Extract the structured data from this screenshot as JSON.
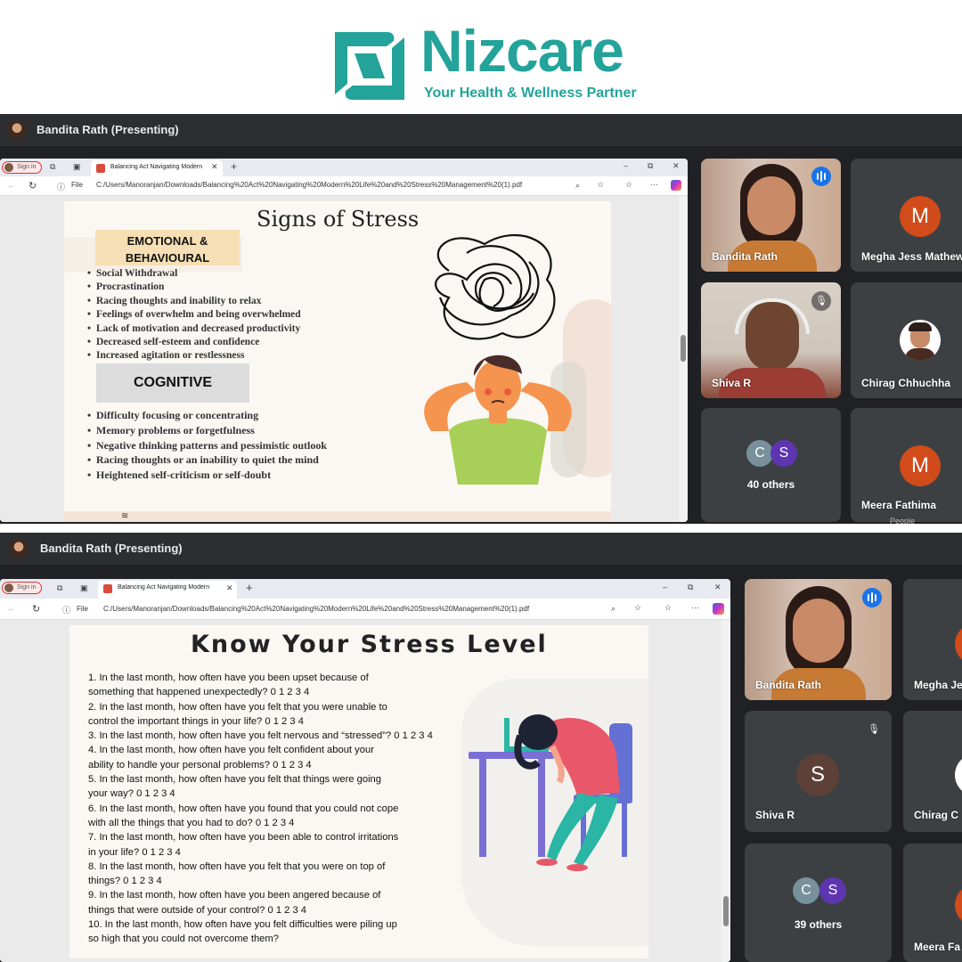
{
  "brand": {
    "name": "Nizcare",
    "tagline": "Your Health & Wellness Partner",
    "color": "#23a39a"
  },
  "screen1": {
    "presenter": "Bandita Rath (Presenting)",
    "browser": {
      "sign_in": "Sign in",
      "tab_title": "Balancing Act Navigating Modern",
      "file_label": "File",
      "url": "C:/Users/Manoranjan/Downloads/Balancing%20Act%20Navigating%20Modern%20Life%20and%20Stress%20Management%20(1).pdf"
    },
    "slide": {
      "title": "Signs of Stress",
      "section1": [
        "EMOTIONAL &",
        "BEHAVIOURAL"
      ],
      "items1": [
        "Social Withdrawal",
        "Procrastination",
        "Racing thoughts and inability to relax",
        "Feelings of overwhelm and being overwhelmed",
        "Lack of motivation and decreased productivity",
        "Decreased self-esteem and confidence",
        "Increased agitation or restlessness"
      ],
      "section2": "COGNITIVE",
      "items2": [
        "Difficulty focusing or concentrating",
        "Memory problems or forgetfulness",
        "Negative thinking patterns and pessimistic outlook",
        "Racing thoughts or an inability to quiet the mind",
        "Heightened self-criticism or self-doubt"
      ]
    },
    "participants": {
      "p1": "Bandita Rath",
      "p2": {
        "name": "Megha Jess Mathew",
        "initial": "M"
      },
      "p3": "Shiva R",
      "p4": "Chirag Chhuchha",
      "others": {
        "count_label": "40 others",
        "a": "C",
        "b": "S"
      },
      "p6": {
        "name": "Meera Fathima",
        "initial": "M"
      },
      "people_label": "People"
    }
  },
  "screen2": {
    "presenter": "Bandita Rath (Presenting)",
    "browser": {
      "sign_in": "Sign in",
      "tab_title": "Balancing Act Navigating Modern",
      "file_label": "File",
      "url": "C:/Users/Manoranjan/Downloads/Balancing%20Act%20Navigating%20Modern%20Life%20and%20Stress%20Management%20(1).pdf"
    },
    "slide": {
      "title": "Know Your Stress Level",
      "questions": [
        "1. In the last month, how often have you been upset because of",
        "something that happened unexpectedly? 0 1 2 3 4",
        "2. In the last month, how often have you felt that you were unable to",
        "control the important things in your life? 0 1 2 3 4",
        "3. In the last month, how often have you felt nervous and “stressed”? 0 1 2 3 4",
        "4. In the last month, how often have you felt confident about your",
        "ability to handle your personal problems? 0 1 2 3 4",
        "5. In the last month, how often have you felt that things were going",
        "your way? 0 1 2 3 4",
        "6. In the last month, how often have you found that you could not cope",
        "with all the things that you had to do? 0 1 2 3 4",
        "7. In the last month, how often have you been able to control irritations",
        "in your life? 0 1 2 3 4",
        "8. In the last month, how often have you felt that you were on top of",
        "things? 0 1 2 3 4",
        "9. In the last month, how often have you been angered because of",
        "things that were outside of your control? 0 1 2 3 4",
        "10. In the last month, how often have you felt difficulties were piling up",
        "so high that you could not overcome them?"
      ]
    },
    "participants": {
      "p1": "Bandita Rath",
      "p2": "Megha Je",
      "p3": {
        "name": "Shiva R",
        "initial": "S"
      },
      "p4": "Chirag C",
      "others": {
        "count_label": "39 others",
        "a": "C",
        "b": "S"
      },
      "p6": "Meera Fa"
    }
  }
}
